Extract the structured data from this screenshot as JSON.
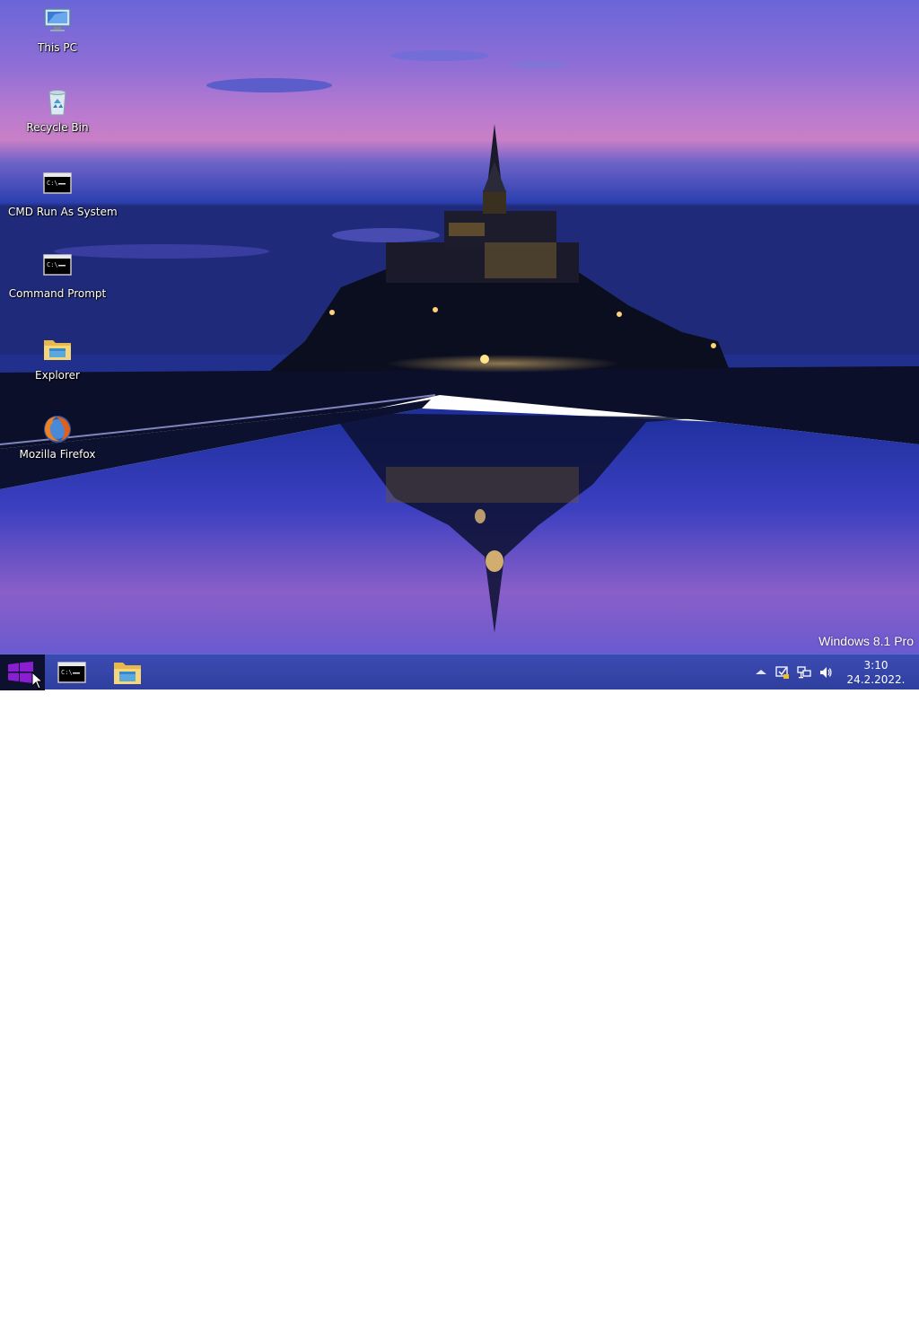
{
  "desktop": {
    "icons": [
      {
        "label": "This PC",
        "icon": "this-pc-icon"
      },
      {
        "label": "Recycle Bin",
        "icon": "recycle-bin-icon"
      },
      {
        "label": "CMD Run As System",
        "icon": "cmd-icon"
      },
      {
        "label": "Command Prompt",
        "icon": "command-prompt-icon"
      },
      {
        "label": "Explorer",
        "icon": "folder-icon"
      },
      {
        "label": "Mozilla Firefox",
        "icon": "firefox-icon"
      }
    ],
    "watermark": "Windows 8.1 Pro",
    "wallpaper": "mont-saint-michel-night"
  },
  "taskbar": {
    "start_icon": "windows-logo-icon",
    "pinned": [
      {
        "name": "command-prompt",
        "icon": "cmd-icon"
      },
      {
        "name": "file-explorer",
        "icon": "folder-icon"
      }
    ],
    "tray_icons": [
      "show-hidden-icons-icon",
      "action-center-icon",
      "network-icon",
      "volume-icon"
    ],
    "clock": {
      "time": "3:10",
      "date": "24.2.2022."
    }
  },
  "colors": {
    "taskbar": "#3346a8",
    "start_button": "#0e1030",
    "windows_logo": "#8a1fd1"
  }
}
